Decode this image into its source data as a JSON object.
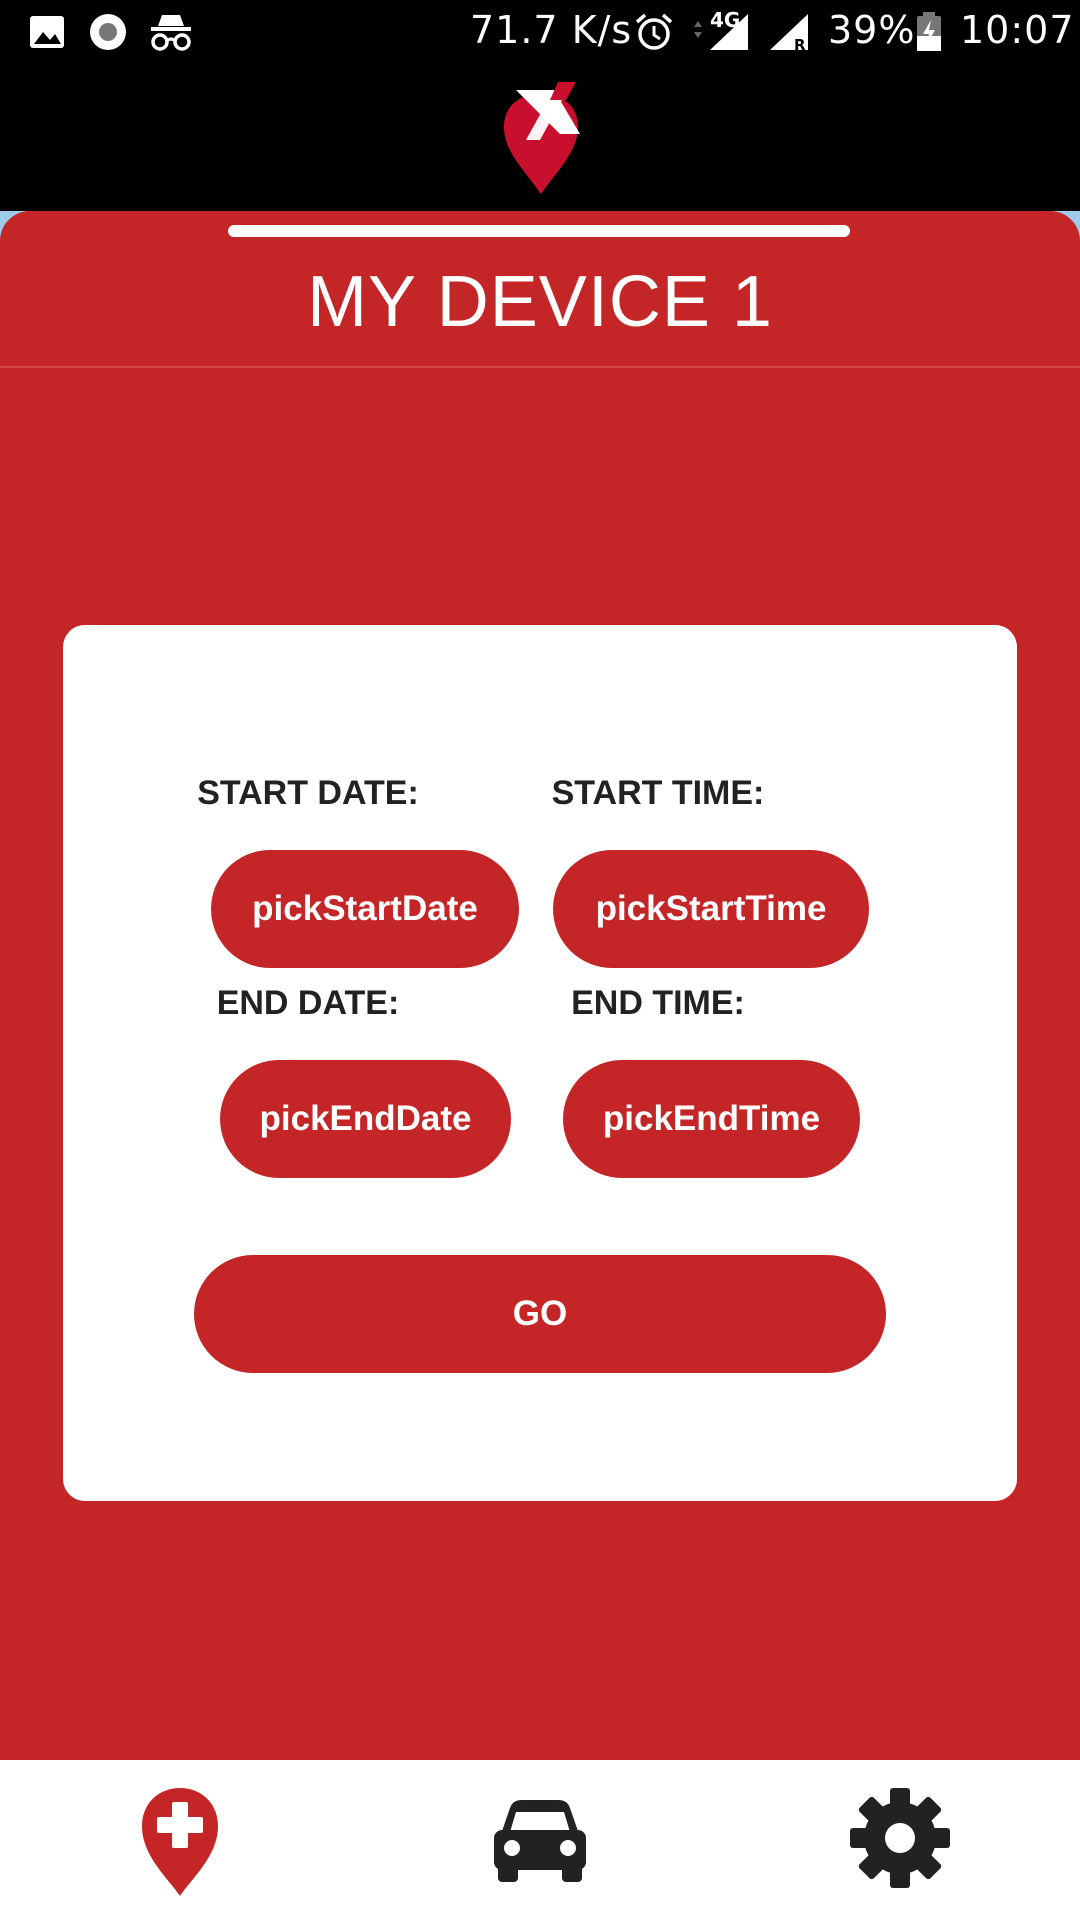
{
  "status_bar": {
    "net_speed": "71.7 K/s",
    "network_type": "4G",
    "battery": "39%",
    "time": "10:07",
    "icons": [
      "image-icon",
      "record-icon",
      "incognito-icon",
      "alarm-icon",
      "signal-icon",
      "signal-roaming-icon",
      "battery-charging-icon"
    ]
  },
  "app": {
    "logo": "location-pin-logo"
  },
  "sheet": {
    "title": "MY DEVICE 1"
  },
  "form": {
    "start_date_label": "START DATE:",
    "start_date_button": "pickStartDate",
    "start_time_label": "START TIME:",
    "start_time_button": "pickStartTime",
    "end_date_label": "END DATE:",
    "end_date_button": "pickEndDate",
    "end_time_label": "END TIME:",
    "end_time_button": "pickEndTime",
    "go_button": "GO"
  },
  "bottom_nav": {
    "items": [
      {
        "icon": "add-location-icon",
        "active": true
      },
      {
        "icon": "car-icon",
        "active": false
      },
      {
        "icon": "settings-gear-icon",
        "active": false
      }
    ]
  },
  "colors": {
    "accent": "#c42627",
    "status_bar_bg": "#000000",
    "card_bg": "#ffffff",
    "label_text": "#222222"
  }
}
